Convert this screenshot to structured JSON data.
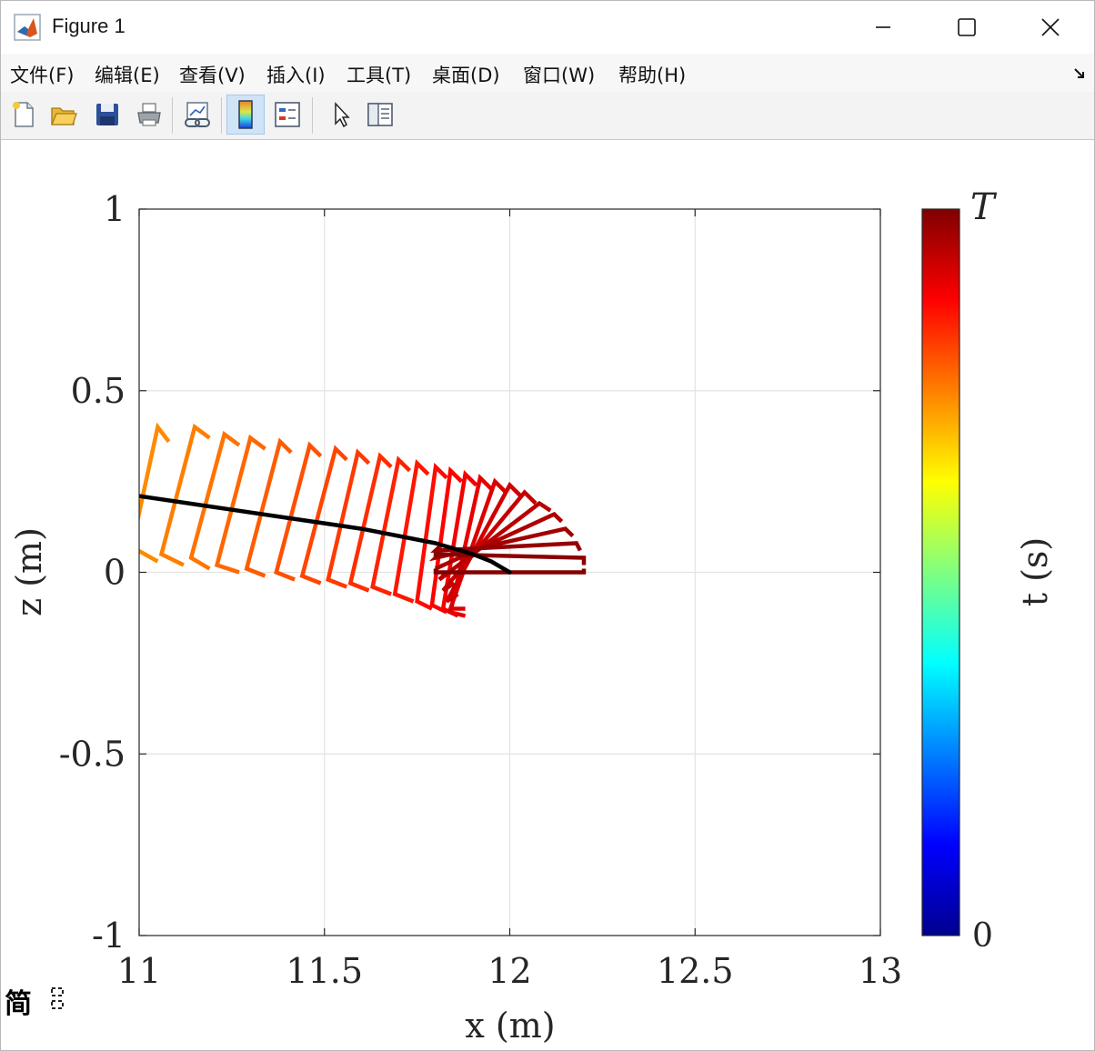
{
  "window": {
    "title": "Figure 1"
  },
  "menu": {
    "items": [
      "文件(F)",
      "编辑(E)",
      "查看(V)",
      "插入(I)",
      "工具(T)",
      "桌面(D)",
      "窗口(W)",
      "帮助(H)"
    ]
  },
  "toolbar": {
    "buttons": [
      "new-figure",
      "open-file",
      "save",
      "print",
      "link-plot",
      "colorbar",
      "legend",
      "edit-plot",
      "property-inspector"
    ]
  },
  "ime": {
    "mode_char": "简"
  },
  "colors": {
    "trajectory": "#000000",
    "grid": "#e3e3e3",
    "colormap": "jet"
  },
  "chart_data": {
    "type": "line",
    "xlabel": "x (m)",
    "ylabel": "z (m)",
    "xlim": [
      11,
      13
    ],
    "ylim": [
      -1,
      1
    ],
    "xticks": [
      "11",
      "11.5",
      "12",
      "12.5",
      "13"
    ],
    "yticks": [
      "1",
      "0.5",
      "0",
      "-0.5",
      "-1"
    ],
    "grid": true,
    "colorbar": {
      "label": "t (s)",
      "top_label": "T",
      "bottom_label": "0",
      "colormap": "jet"
    },
    "series": [
      {
        "kind": "trajectory",
        "color": "#000000",
        "x": [
          11.0,
          11.2,
          11.4,
          11.6,
          11.7,
          11.8,
          11.9,
          11.95,
          12.0
        ],
        "z": [
          0.21,
          0.18,
          0.15,
          0.12,
          0.1,
          0.08,
          0.05,
          0.03,
          0.0
        ]
      }
    ],
    "snapshots": {
      "color_from": 0.74,
      "color_to": 1.0,
      "frames": [
        {
          "hx": 11.05,
          "hz": 0.4,
          "ax": 10.98,
          "az": 0.07,
          "tx": 11.08,
          "tz": 0.36,
          "kx": 11.05,
          "kz": 0.03
        },
        {
          "hx": 11.15,
          "hz": 0.4,
          "ax": 11.06,
          "az": 0.05,
          "tx": 11.19,
          "tz": 0.37,
          "kx": 11.12,
          "kz": 0.02
        },
        {
          "hx": 11.23,
          "hz": 0.38,
          "ax": 11.14,
          "az": 0.04,
          "tx": 11.27,
          "tz": 0.35,
          "kx": 11.19,
          "kz": 0.01
        },
        {
          "hx": 11.3,
          "hz": 0.37,
          "ax": 11.21,
          "az": 0.02,
          "tx": 11.34,
          "tz": 0.34,
          "kx": 11.27,
          "kz": 0.0
        },
        {
          "hx": 11.38,
          "hz": 0.36,
          "ax": 11.29,
          "az": 0.01,
          "tx": 11.41,
          "tz": 0.33,
          "kx": 11.34,
          "kz": -0.01
        },
        {
          "hx": 11.46,
          "hz": 0.35,
          "ax": 11.37,
          "az": 0.0,
          "tx": 11.49,
          "tz": 0.32,
          "kx": 11.42,
          "kz": -0.02
        },
        {
          "hx": 11.53,
          "hz": 0.34,
          "ax": 11.44,
          "az": -0.01,
          "tx": 11.56,
          "tz": 0.31,
          "kx": 11.49,
          "kz": -0.03
        },
        {
          "hx": 11.59,
          "hz": 0.33,
          "ax": 11.51,
          "az": -0.02,
          "tx": 11.62,
          "tz": 0.3,
          "kx": 11.56,
          "kz": -0.04
        },
        {
          "hx": 11.65,
          "hz": 0.32,
          "ax": 11.57,
          "az": -0.03,
          "tx": 11.68,
          "tz": 0.29,
          "kx": 11.62,
          "kz": -0.05
        },
        {
          "hx": 11.7,
          "hz": 0.31,
          "ax": 11.63,
          "az": -0.04,
          "tx": 11.73,
          "tz": 0.28,
          "kx": 11.68,
          "kz": -0.06
        },
        {
          "hx": 11.75,
          "hz": 0.3,
          "ax": 11.69,
          "az": -0.06,
          "tx": 11.78,
          "tz": 0.27,
          "kx": 11.74,
          "kz": -0.08
        },
        {
          "hx": 11.8,
          "hz": 0.29,
          "ax": 11.75,
          "az": -0.08,
          "tx": 11.83,
          "tz": 0.26,
          "kx": 11.79,
          "kz": -0.1
        },
        {
          "hx": 11.84,
          "hz": 0.28,
          "ax": 11.79,
          "az": -0.09,
          "tx": 11.87,
          "tz": 0.25,
          "kx": 11.83,
          "kz": -0.11
        },
        {
          "hx": 11.88,
          "hz": 0.27,
          "ax": 11.82,
          "az": -0.1,
          "tx": 11.91,
          "tz": 0.24,
          "kx": 11.86,
          "kz": -0.12
        },
        {
          "hx": 11.92,
          "hz": 0.26,
          "ax": 11.84,
          "az": -0.11,
          "tx": 11.95,
          "tz": 0.23,
          "kx": 11.88,
          "kz": -0.12
        },
        {
          "hx": 11.96,
          "hz": 0.25,
          "ax": 11.84,
          "az": -0.1,
          "tx": 11.99,
          "tz": 0.22,
          "kx": 11.88,
          "kz": -0.1
        },
        {
          "hx": 12.0,
          "hz": 0.24,
          "ax": 11.83,
          "az": -0.08,
          "tx": 12.03,
          "tz": 0.21,
          "kx": 11.86,
          "kz": -0.06
        },
        {
          "hx": 12.04,
          "hz": 0.22,
          "ax": 11.82,
          "az": -0.05,
          "tx": 12.07,
          "tz": 0.19,
          "kx": 11.85,
          "kz": -0.03
        },
        {
          "hx": 12.08,
          "hz": 0.19,
          "ax": 11.81,
          "az": -0.02,
          "tx": 12.11,
          "tz": 0.17,
          "kx": 11.83,
          "kz": 0.0
        },
        {
          "hx": 12.12,
          "hz": 0.16,
          "ax": 11.8,
          "az": 0.01,
          "tx": 12.14,
          "tz": 0.14,
          "kx": 11.82,
          "kz": 0.02
        },
        {
          "hx": 12.15,
          "hz": 0.12,
          "ax": 11.8,
          "az": 0.04,
          "tx": 12.17,
          "tz": 0.1,
          "kx": 11.81,
          "kz": 0.05
        },
        {
          "hx": 12.18,
          "hz": 0.08,
          "ax": 11.8,
          "az": 0.06,
          "tx": 12.19,
          "tz": 0.06,
          "kx": 11.81,
          "kz": 0.07
        },
        {
          "hx": 12.2,
          "hz": 0.04,
          "ax": 11.8,
          "az": 0.05,
          "tx": 12.2,
          "tz": 0.02,
          "kx": 11.8,
          "kz": 0.04
        },
        {
          "hx": 12.2,
          "hz": 0.0,
          "ax": 11.8,
          "az": 0.0,
          "tx": 12.2,
          "tz": 0.01,
          "kx": 11.8,
          "kz": 0.01
        }
      ]
    }
  }
}
